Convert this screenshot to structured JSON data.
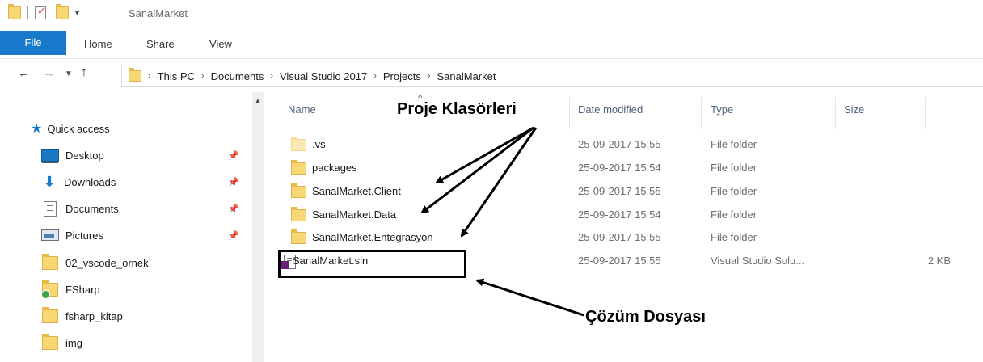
{
  "window": {
    "title": "SanalMarket",
    "quick_access_toolbar": [
      "folder-icon",
      "properties-icon",
      "new-folder-icon",
      "customize-dropdown"
    ]
  },
  "ribbon": {
    "tabs": [
      {
        "label": "File",
        "active": true
      },
      {
        "label": "Home"
      },
      {
        "label": "Share"
      },
      {
        "label": "View"
      }
    ]
  },
  "nav": {
    "back_glyph": "←",
    "forward_glyph": "→",
    "recent_glyph": "⌄",
    "up_glyph": "↑",
    "breadcrumbs": [
      "This PC",
      "Documents",
      "Visual Studio 2017",
      "Projects",
      "SanalMarket"
    ]
  },
  "sidebar": {
    "quick_access_label": "Quick access",
    "items": [
      {
        "label": "Desktop",
        "icon": "desktop-icon",
        "pinned": true
      },
      {
        "label": "Downloads",
        "icon": "downloads-icon",
        "pinned": true
      },
      {
        "label": "Documents",
        "icon": "documents-icon",
        "pinned": true
      },
      {
        "label": "Pictures",
        "icon": "pictures-icon",
        "pinned": true
      },
      {
        "label": "02_vscode_ornek",
        "icon": "folder-icon"
      },
      {
        "label": "FSharp",
        "icon": "folder-sync-icon"
      },
      {
        "label": "fsharp_kitap",
        "icon": "folder-icon"
      },
      {
        "label": "img",
        "icon": "folder-icon"
      }
    ]
  },
  "filelist": {
    "columns": [
      "Name",
      "Date modified",
      "Type",
      "Size"
    ],
    "rows": [
      {
        "name": ".vs",
        "date": "25-09-2017 15:55",
        "type": "File folder",
        "size": ""
      },
      {
        "name": "packages",
        "date": "25-09-2017 15:54",
        "type": "File folder",
        "size": ""
      },
      {
        "name": "SanalMarket.Client",
        "date": "25-09-2017 15:55",
        "type": "File folder",
        "size": ""
      },
      {
        "name": "SanalMarket.Data",
        "date": "25-09-2017 15:54",
        "type": "File folder",
        "size": ""
      },
      {
        "name": "SanalMarket.Entegrasyon",
        "date": "25-09-2017 15:55",
        "type": "File folder",
        "size": ""
      },
      {
        "name": "SanalMarket.sln",
        "date": "25-09-2017 15:55",
        "type": "Visual Studio Solu...",
        "size": "2 KB"
      }
    ]
  },
  "annotations": {
    "project_folders": "Proje Klasörleri",
    "solution_file": "Çözüm Dosyası"
  },
  "colors": {
    "accent": "#1979ca",
    "folder": "#f8d775",
    "vs_purple": "#68217a"
  }
}
